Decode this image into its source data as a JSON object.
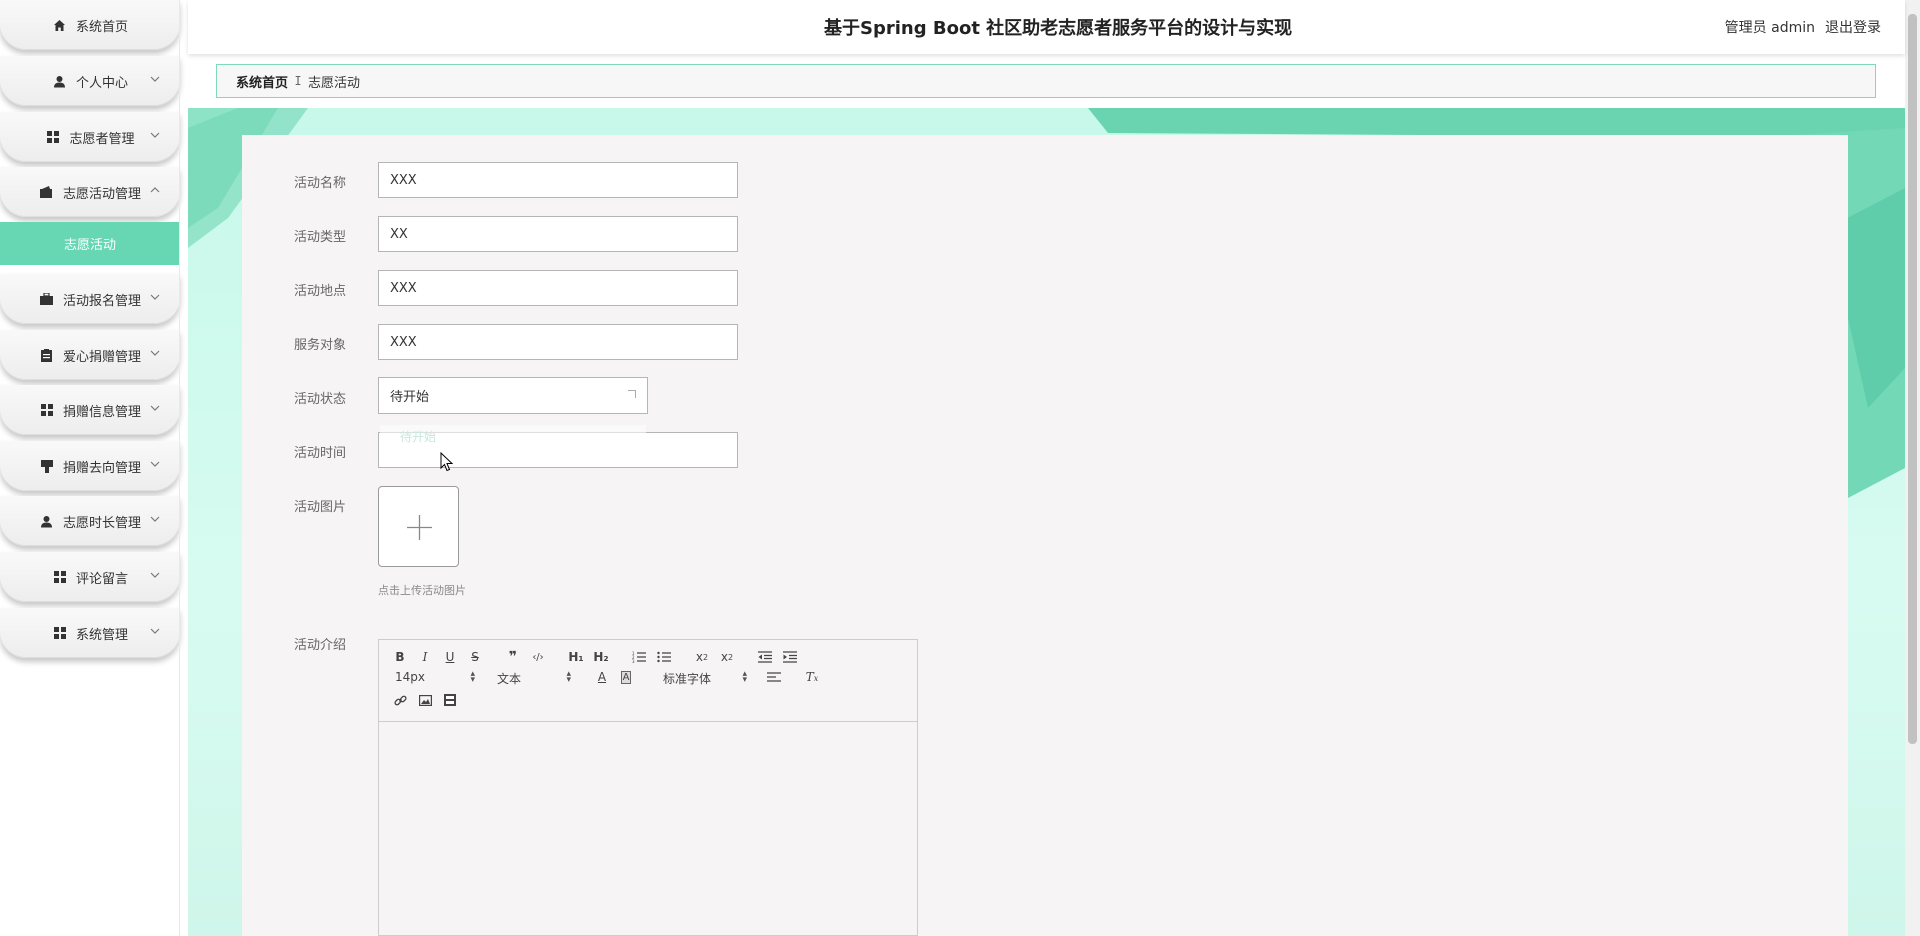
{
  "app": {
    "title": "基于Spring Boot 社区助老志愿者服务平台的设计与实现",
    "user_text": "管理员 admin",
    "logout_label": "退出登录",
    "accent_color": "#67d6b2"
  },
  "sidebar": {
    "items": [
      {
        "label": "系统首页",
        "icon": "home-icon"
      },
      {
        "label": "个人中心",
        "icon": "user-icon"
      },
      {
        "label": "志愿者管理",
        "icon": "grid-icon"
      },
      {
        "label": "志愿活动管理",
        "icon": "wallet-icon"
      },
      {
        "label": "活动报名管理",
        "icon": "briefcase-icon"
      },
      {
        "label": "爱心捐赠管理",
        "icon": "clipboard-icon"
      },
      {
        "label": "捐赠信息管理",
        "icon": "grid-icon"
      },
      {
        "label": "捐赠去向管理",
        "icon": "sign-icon"
      },
      {
        "label": "志愿时长管理",
        "icon": "user-icon"
      },
      {
        "label": "评论留言",
        "icon": "grid-icon"
      },
      {
        "label": "系统管理",
        "icon": "grid-icon"
      }
    ],
    "active_sub": "志愿活动"
  },
  "breadcrumb": {
    "home": "系统首页",
    "separator": "ⵊ",
    "current": "志愿活动"
  },
  "form": {
    "name_label": "活动名称",
    "name_value": "XXX",
    "type_label": "活动类型",
    "type_value": "XX",
    "location_label": "活动地点",
    "location_value": "XXX",
    "target_label": "服务对象",
    "target_value": "XXX",
    "status_label": "活动状态",
    "status_value": "待开始",
    "time_label": "活动时间",
    "time_ghost": "待开始",
    "image_label": "活动图片",
    "upload_hint": "点击上传活动图片",
    "intro_label": "活动介绍"
  },
  "editor": {
    "size_value": "14px",
    "header_value": "文本",
    "font_value": "标准字体",
    "h1": "H₁",
    "h2": "H₂"
  }
}
